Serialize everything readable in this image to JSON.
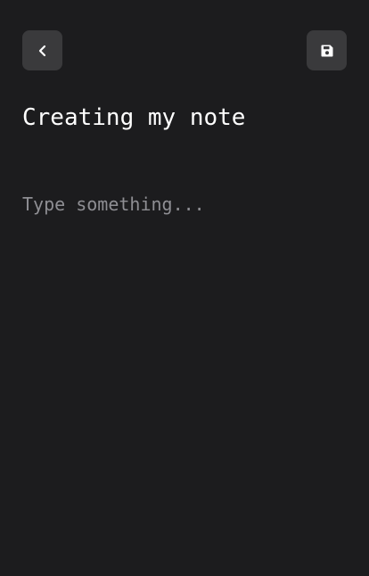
{
  "header": {
    "back_icon": "chevron-left-icon",
    "save_icon": "floppy-disk-icon"
  },
  "note": {
    "title": "Creating my note",
    "body_value": "",
    "body_placeholder": "Type something..."
  },
  "colors": {
    "background": "#1c1c1e",
    "button_bg": "#3a3a3c",
    "text": "#ffffff",
    "placeholder": "#8e8e93"
  }
}
